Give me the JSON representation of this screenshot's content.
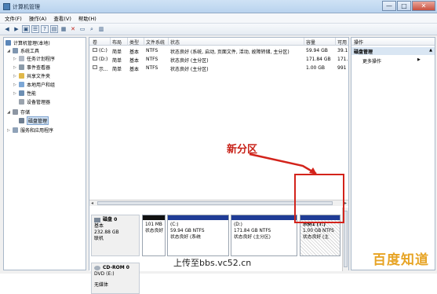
{
  "window": {
    "title": "计算机管理",
    "buttons": [
      "—",
      "□",
      "✕"
    ]
  },
  "menu": [
    "文件(F)",
    "操作(A)",
    "查看(V)",
    "帮助(H)"
  ],
  "toolbar": [
    "back-icon",
    "forward-icon",
    "up-icon",
    "list-icon",
    "help-icon",
    "properties-icon",
    "view-icon",
    "delete-icon",
    "open-icon",
    "search-icon",
    "format-icon"
  ],
  "tree": {
    "root": "计算机管理(本地)",
    "system_tools": "系统工具",
    "items": [
      "任务计划程序",
      "事件查看器",
      "共享文件夹",
      "本地用户和组",
      "性能",
      "设备管理器"
    ],
    "storage": "存储",
    "disk_mgmt": "磁盘管理",
    "services": "服务和应用程序"
  },
  "volume_list": {
    "headers": [
      "卷",
      "布局",
      "类型",
      "文件系统",
      "状态",
      "容量",
      "可用"
    ],
    "rows": [
      [
        "(C:)",
        "简单",
        "基本",
        "NTFS",
        "状态良好 (系统, 启动, 页面文件, 活动, 故障转储, 主分区)",
        "59.94 GB",
        "39.1"
      ],
      [
        "(D:)",
        "简单",
        "基本",
        "NTFS",
        "状态良好 (主分区)",
        "171.84 GB",
        "171."
      ],
      [
        "示...",
        "简单",
        "基本",
        "NTFS",
        "状态良好 (主分区)",
        "1.00 GB",
        "991"
      ]
    ]
  },
  "disks": {
    "disk0": {
      "name": "磁盘 0",
      "type": "基本",
      "size": "232.88 GB",
      "status": "联机"
    },
    "partitions": [
      {
        "name": "",
        "size": "101 MB",
        "status": "状态良好"
      },
      {
        "name": "(C:)",
        "size": "59.94 GB NTFS",
        "status": "状态良好 (系统"
      },
      {
        "name": "(D:)",
        "size": "171.84 GB NTFS",
        "status": "状态良好 (主分区)"
      },
      {
        "name": "示例1 (T:)",
        "size": "1.00 GB NTFS",
        "status": "状态良好 (主"
      }
    ],
    "cdrom": {
      "name": "CD-ROM 0",
      "type": "DVD (E:)",
      "status": "无媒体"
    }
  },
  "actions": {
    "header": "操作",
    "group": "磁盘管理",
    "more": "更多操作"
  },
  "annotation": "新分区",
  "watermark": {
    "upload": "上传至bbs.vc52.cn",
    "logo": "百度知道"
  },
  "colors": {
    "partition_blue": "#1f3c96",
    "partition_black": "#111111",
    "annotation_red": "#d3231b"
  }
}
